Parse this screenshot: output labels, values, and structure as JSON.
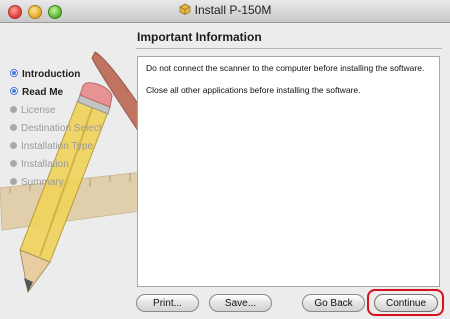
{
  "window": {
    "title": "Install P-150M"
  },
  "header": {
    "heading": "Important Information"
  },
  "sidebar": {
    "steps": [
      {
        "label": "Introduction",
        "state": "done"
      },
      {
        "label": "Read Me",
        "state": "current"
      },
      {
        "label": "License",
        "state": "pending"
      },
      {
        "label": "Destination Select",
        "state": "pending"
      },
      {
        "label": "Installation Type",
        "state": "pending"
      },
      {
        "label": "Installation",
        "state": "pending"
      },
      {
        "label": "Summary",
        "state": "pending"
      }
    ]
  },
  "content": {
    "paragraphs": [
      "Do not connect the scanner to the computer before installing the software.",
      "Close all other applications before installing the software."
    ]
  },
  "buttons": {
    "print": "Print...",
    "save": "Save...",
    "go_back": "Go Back",
    "continue": "Continue"
  },
  "colors": {
    "highlight": "#d80f1c",
    "step_done_accent": "#4c7bd8"
  },
  "icons": {
    "window_icon": "installer-package-icon",
    "background_art": "pencil-ruler-brush-artwork"
  }
}
